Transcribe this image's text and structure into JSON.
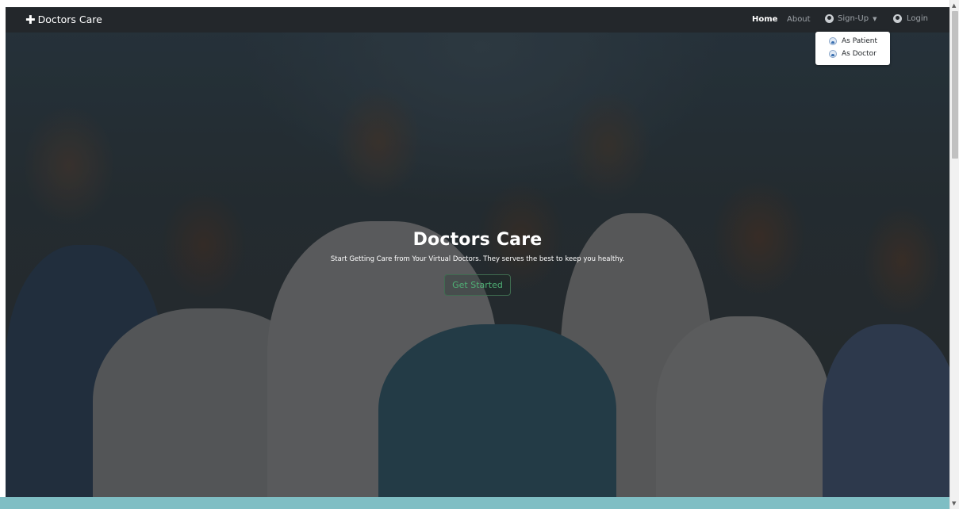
{
  "navbar": {
    "brand": "Doctors Care",
    "brand_icon": "plus-icon",
    "links": {
      "home": "Home",
      "about": "About",
      "signup": "Sign-Up",
      "login": "Login"
    },
    "signup_dropdown": [
      {
        "label": "As Patient",
        "icon": "user-icon"
      },
      {
        "label": "As Doctor",
        "icon": "user-icon"
      }
    ]
  },
  "hero": {
    "title": "Doctors Care",
    "subtitle": "Start Getting Care from Your Virtual Doctors. They serves the best to keep you healthy.",
    "cta": "Get Started"
  },
  "colors": {
    "navbar_bg": "#23272b",
    "cta_text": "#4fb075",
    "cta_border": "#3f6c50",
    "section_teal": "#7fbec4"
  }
}
